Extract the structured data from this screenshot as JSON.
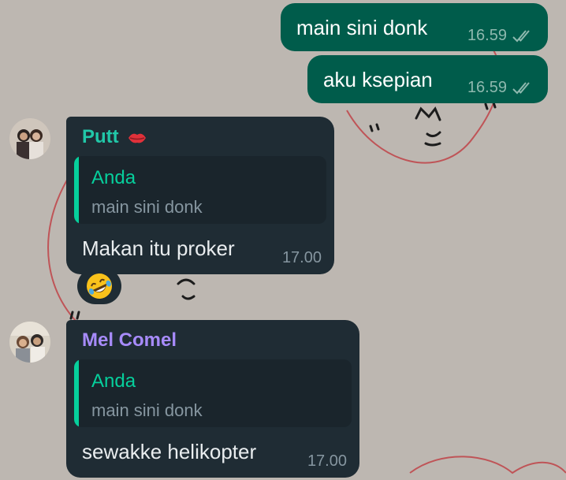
{
  "messages": [
    {
      "type": "outgoing",
      "text": "main sini donk",
      "time": "16.59"
    },
    {
      "type": "outgoing",
      "text": "aku ksepian",
      "time": "16.59"
    },
    {
      "type": "incoming",
      "sender": "Putt",
      "sender_emoji_icon": "lips-icon",
      "reply_to": {
        "author": "Anda",
        "text": "main sini donk"
      },
      "text": "Makan itu proker",
      "time": "17.00",
      "reaction": "rolling-on-floor-laughing-emoji"
    },
    {
      "type": "incoming",
      "sender": "Mel Comel",
      "reply_to": {
        "author": "Anda",
        "text": "main sini donk"
      },
      "text": "sewakke helikopter",
      "time": "17.00"
    }
  ],
  "colors": {
    "outgoing_bubble": "#005c4b",
    "incoming_bubble": "#1f2c34",
    "sender_putt": "#21c7a8",
    "sender_mel": "#a78bfa",
    "quote_accent": "#06cf9c",
    "wallpaper": "#bdb7b1"
  },
  "icons": {
    "read_receipt": "double-check-icon"
  }
}
